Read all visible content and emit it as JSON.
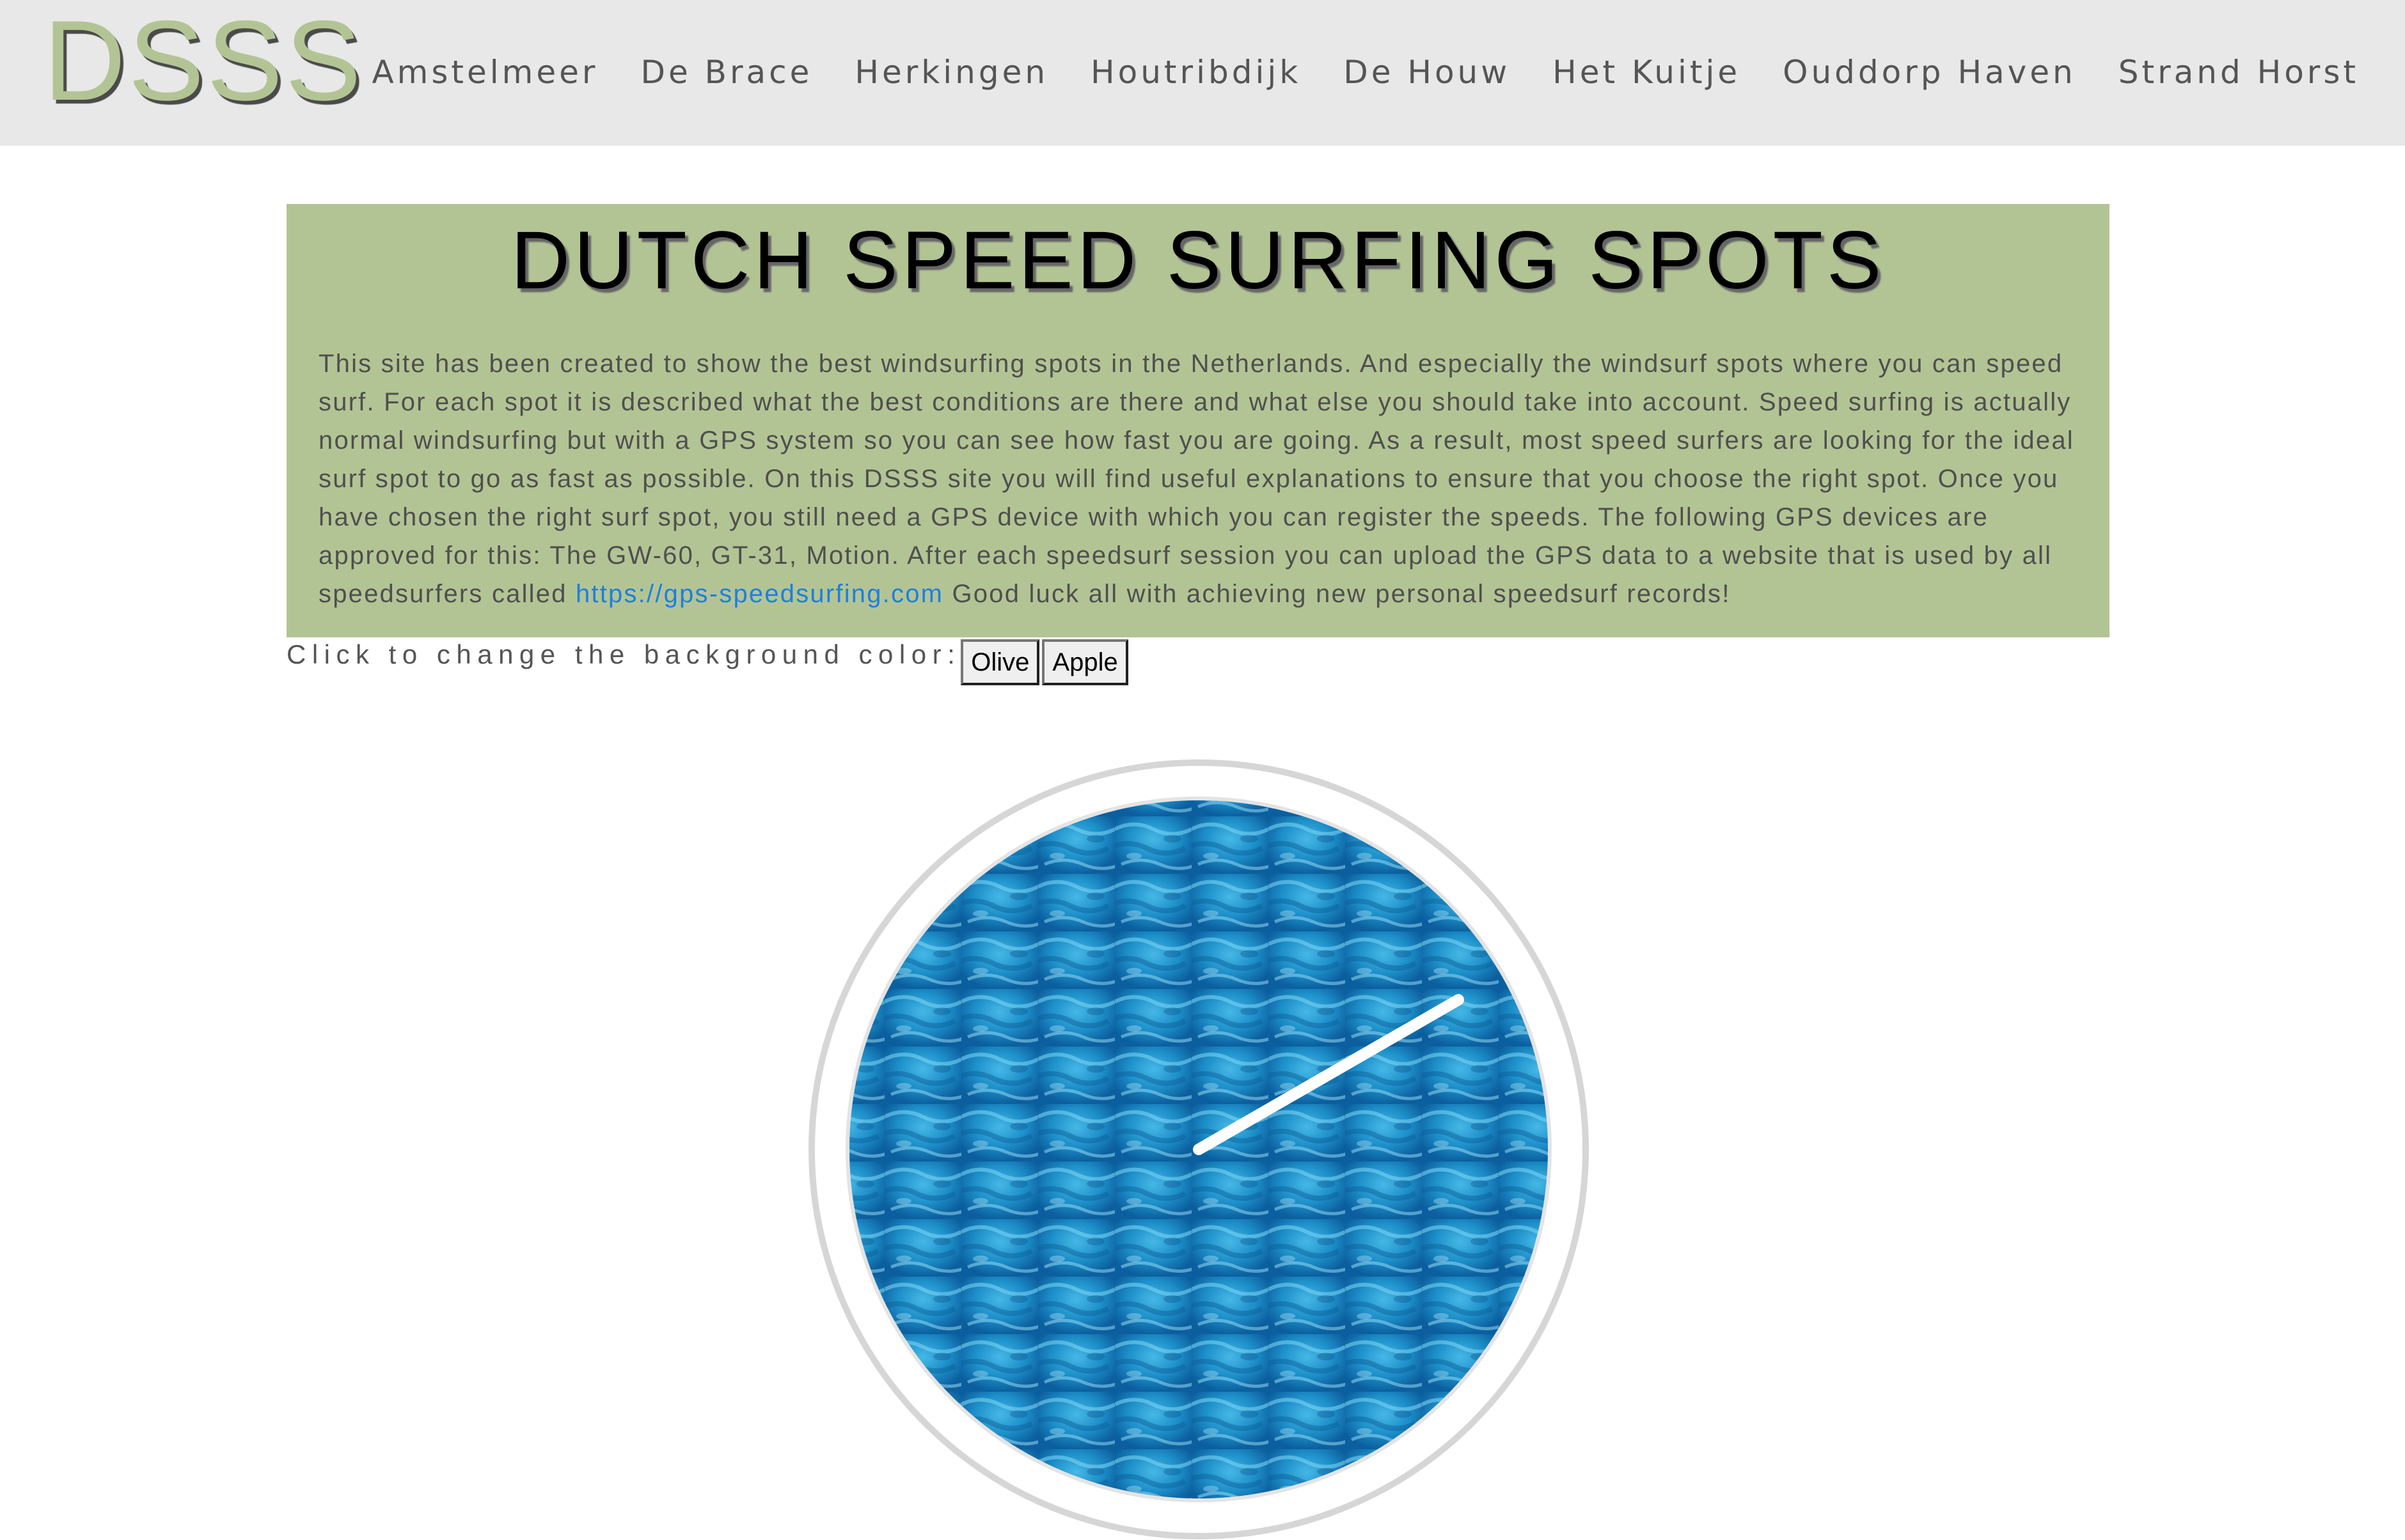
{
  "header": {
    "logo": "DSSS",
    "nav": [
      "Amstelmeer",
      "De Brace",
      "Herkingen",
      "Houtribdijk",
      "De Houw",
      "Het Kuitje",
      "Ouddorp Haven",
      "Strand Horst"
    ]
  },
  "intro": {
    "title": "DUTCH SPEED SURFING SPOTS",
    "text_before_link": "This site has been created to show the best windsurfing spots in the Netherlands. And especially the windsurf spots where you can speed surf. For each spot it is described what the best conditions are there and what else you should take into account. Speed surfing is actually normal windsurfing but with a GPS system so you can see how fast you are going. As a result, most speed surfers are looking for the ideal surf spot to go as fast as possible. On this DSSS site you will find useful explanations to ensure that you choose the right spot. Once you have chosen the right surf spot, you still need a GPS device with which you can register the speeds. The following GPS devices are approved for this: The GW-60, GT-31, Motion. After each speedsurf session you can upload the GPS data to a website that is used by all speedsurfers called ",
    "link_text": "https://gps-speedsurfing.com",
    "text_after_link": " Good luck all with achieving new personal speedsurf records!"
  },
  "background_control": {
    "label": "Click to change the background color:",
    "buttons": [
      "Olive",
      "Apple"
    ]
  },
  "colors": {
    "olive": "#b3c494",
    "header_bg": "#e8e8e8",
    "link": "#1e7fe0",
    "water": "#1d8fc9"
  },
  "clock": {
    "face_icon": "water-clock-face",
    "hand_icon": "clock-hand"
  }
}
